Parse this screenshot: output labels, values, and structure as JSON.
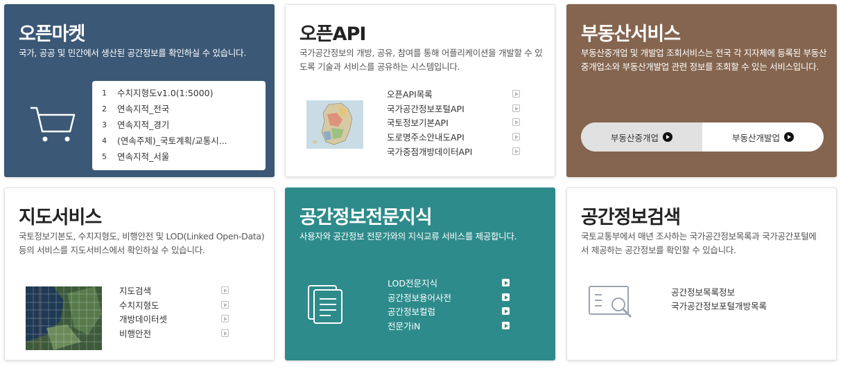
{
  "open_market": {
    "title": "오픈마켓",
    "desc": "국가, 공공 및 민간에서 생산된 공간정보를 확인하실 수 있습니다.",
    "ranks": [
      {
        "num": "1",
        "label": "수치지형도v1.0(1:5000)"
      },
      {
        "num": "2",
        "label": "연속지적_전국"
      },
      {
        "num": "3",
        "label": "연속지적_경기"
      },
      {
        "num": "4",
        "label": "(연속주제)_국토계획/교통시..."
      },
      {
        "num": "5",
        "label": "연속지적_서울"
      }
    ]
  },
  "open_api": {
    "title": "오픈API",
    "desc": "국가공간정보의 개방, 공유, 참여를 통해 어플리케이션을 개발할 수 있도록 기술과 서비스를 공유하는 시스템입니다.",
    "links": [
      "오픈API목록",
      "국가공간정보포털API",
      "국토정보기본API",
      "도로명주소안내도API",
      "국가중점개방데이터API"
    ]
  },
  "real_estate": {
    "title": "부동산서비스",
    "desc": "부동산중개업 및 개발업 조회서비스는 전국 각 지자체에 등록된 부동산중개업소와 부동산개발업 관련 정보를 조회할 수 있는 서비스입니다.",
    "tab1": "부동산중개업",
    "tab2": "부동산개발업"
  },
  "map_service": {
    "title": "지도서비스",
    "desc": "국토정보기본도, 수치지형도, 비행안전 및 LOD(Linked Open-Data) 등의 서비스를 지도서비스에서 확인하실 수 있습니다.",
    "links": [
      "지도검색",
      "수치지형도",
      "개방데이터셋",
      "비행안전"
    ]
  },
  "expert": {
    "title": "공간정보전문지식",
    "desc": "사용자와 공간정보 전문가와의 지식교류 서비스를 제공합니다.",
    "links": [
      "LOD전문지식",
      "공간정보용어사전",
      "공간정보컬럼",
      "전문가iN"
    ]
  },
  "search": {
    "title": "공간정보검색",
    "desc": "국토교통부에서 매년 조사하는 국가공간정보목록과 국가공간포털에서 제공하는 공간정보를 확인할 수 있습니다.",
    "links": [
      "공간정보목록정보",
      "국가공간정보포털개방목록"
    ]
  }
}
